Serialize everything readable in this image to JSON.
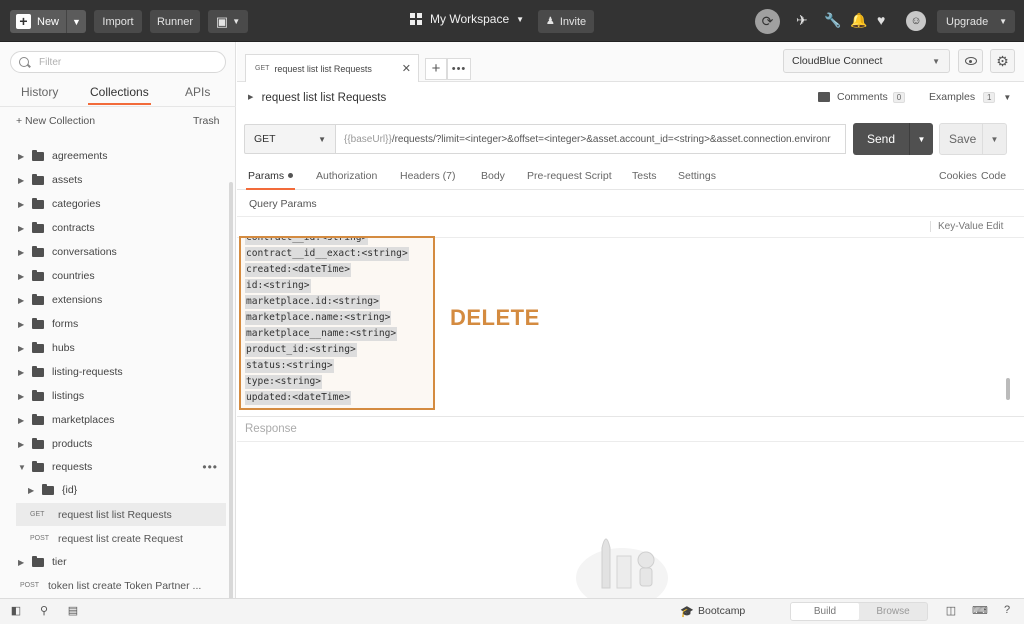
{
  "topbar": {
    "new_label": "New",
    "import_label": "Import",
    "runner_label": "Runner",
    "workspace": "My Workspace",
    "invite_label": "Invite",
    "upgrade_label": "Upgrade"
  },
  "sidebar": {
    "filter_placeholder": "Filter",
    "tabs": [
      "History",
      "Collections",
      "APIs"
    ],
    "active_tab": "Collections",
    "new_collection": "+ New Collection",
    "trash": "Trash",
    "folders": [
      "agreements",
      "assets",
      "categories",
      "contracts",
      "conversations",
      "countries",
      "extensions",
      "forms",
      "hubs",
      "listing-requests",
      "listings",
      "marketplaces",
      "products",
      "requests"
    ],
    "sub_folder": "{id}",
    "requests": [
      {
        "method": "GET",
        "name": "request list list Requests",
        "selected": true
      },
      {
        "method": "POST",
        "name": "request list create Request",
        "selected": false
      }
    ],
    "tier_folder": "tier",
    "token_request": {
      "method": "POST",
      "name": "token list create Token Partner ..."
    }
  },
  "tab": {
    "method": "GET",
    "title": "request list list Requests"
  },
  "environment": "CloudBlue Connect",
  "request": {
    "title": "request list list Requests",
    "comments_label": "Comments",
    "comments_count": "0",
    "examples_label": "Examples",
    "examples_count": "1",
    "method": "GET",
    "url_var": "{{baseUrl}}",
    "url_rest": "/requests/?limit=<integer>&offset=<integer>&asset.account_id=<string>&asset.connection.environr",
    "send_label": "Send",
    "save_label": "Save"
  },
  "subtabs": {
    "params": "Params",
    "authorization": "Authorization",
    "headers": "Headers (7)",
    "body": "Body",
    "prerequest": "Pre-request Script",
    "tests": "Tests",
    "settings": "Settings",
    "cookies": "Cookies",
    "code": "Code"
  },
  "query_params_title": "Query Params",
  "kv_edit": "Key-Value Edit",
  "bulk_lines": [
    "contract__id:<string>",
    "contract__id__exact:<string>",
    "created:<dateTime>",
    "id:<string>",
    "marketplace.id:<string>",
    "marketplace.name:<string>",
    "marketplace__name:<string>",
    "product_id:<string>",
    "status:<string>",
    "type:<string>",
    "updated:<dateTime>"
  ],
  "annotation": "DELETE",
  "response_label": "Response",
  "statusbar": {
    "bootcamp": "Bootcamp",
    "build": "Build",
    "browse": "Browse"
  },
  "colors": {
    "accent": "#f26b3a",
    "annotation": "#d48b40",
    "topbar": "#333333",
    "send": "#505050"
  }
}
